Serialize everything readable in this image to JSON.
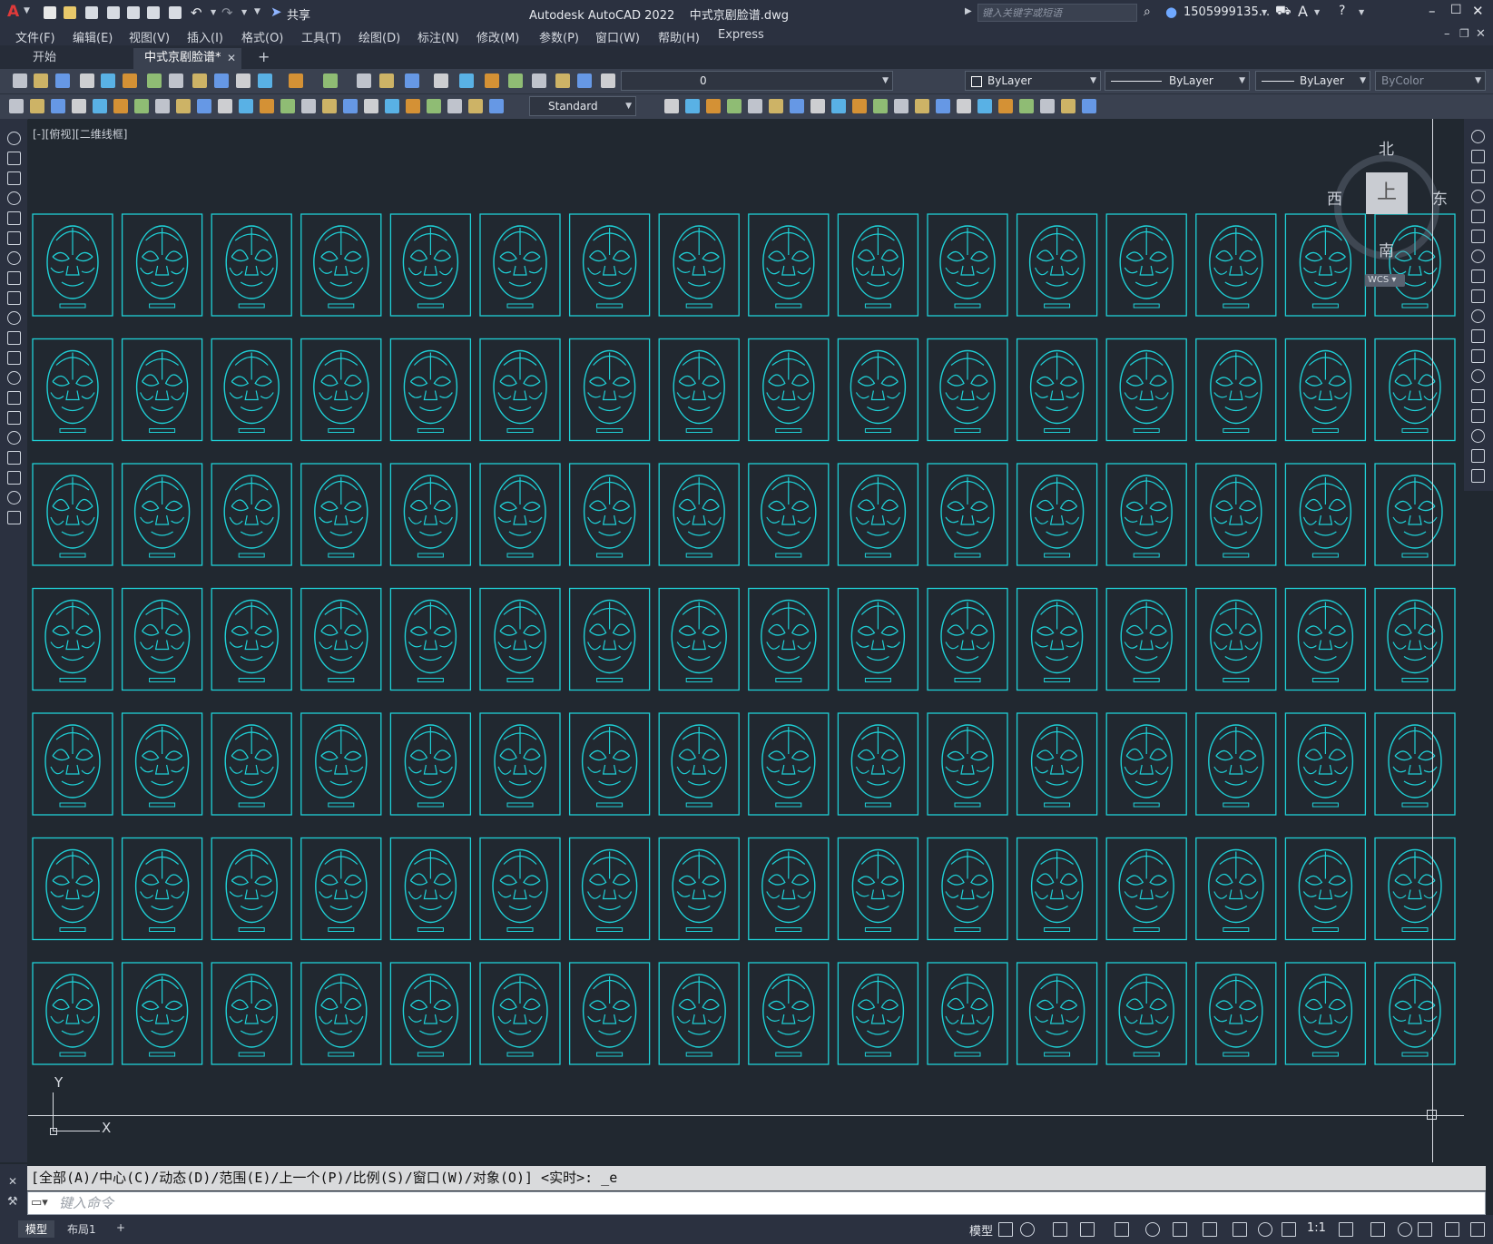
{
  "app": {
    "title": "Autodesk AutoCAD 2022",
    "filename": "中式京剧脸谱.dwg",
    "share_label": "共享",
    "search_placeholder": "键入关键字或短语",
    "username": "1505999135...",
    "logo_letter": "A"
  },
  "menu": [
    {
      "label": "文件(F)"
    },
    {
      "label": "编辑(E)"
    },
    {
      "label": "视图(V)"
    },
    {
      "label": "插入(I)"
    },
    {
      "label": "格式(O)"
    },
    {
      "label": "工具(T)"
    },
    {
      "label": "绘图(D)"
    },
    {
      "label": "标注(N)"
    },
    {
      "label": "修改(M)"
    },
    {
      "label": "参数(P)"
    },
    {
      "label": "窗口(W)"
    },
    {
      "label": "帮助(H)"
    },
    {
      "label": "Express"
    }
  ],
  "tabs": {
    "start": "开始",
    "active": "中式京剧脸谱*",
    "close": "✕",
    "add": "+"
  },
  "properties": {
    "layer": "0",
    "color": "ByLayer",
    "linetype": "ByLayer",
    "lineweight": "ByLayer",
    "plotstyle": "ByColor",
    "textstyle": "Standard"
  },
  "viewport": {
    "label": "[-][俯视][二维线框]",
    "viewcube": {
      "north": "北",
      "south": "南",
      "east": "东",
      "west": "西",
      "top": "上",
      "wcs": "WCS"
    },
    "ucs": {
      "x": "X",
      "y": "Y"
    }
  },
  "drawing": {
    "rows": 7,
    "columns": 16,
    "stroke_color": "#1fd0d6"
  },
  "command": {
    "history": "[全部(A)/中心(C)/动态(D)/范围(E)/上一个(P)/比例(S)/窗口(W)/对象(O)] <实时>: _e",
    "placeholder": "键入命令"
  },
  "status": {
    "model_tab": "模型",
    "layout_tab": "布局1",
    "add": "+",
    "model_space": "模型",
    "scale": "1:1"
  },
  "colors": {
    "accent": "#1fd0d6",
    "background": "#212830",
    "chrome": "#2b3140"
  }
}
